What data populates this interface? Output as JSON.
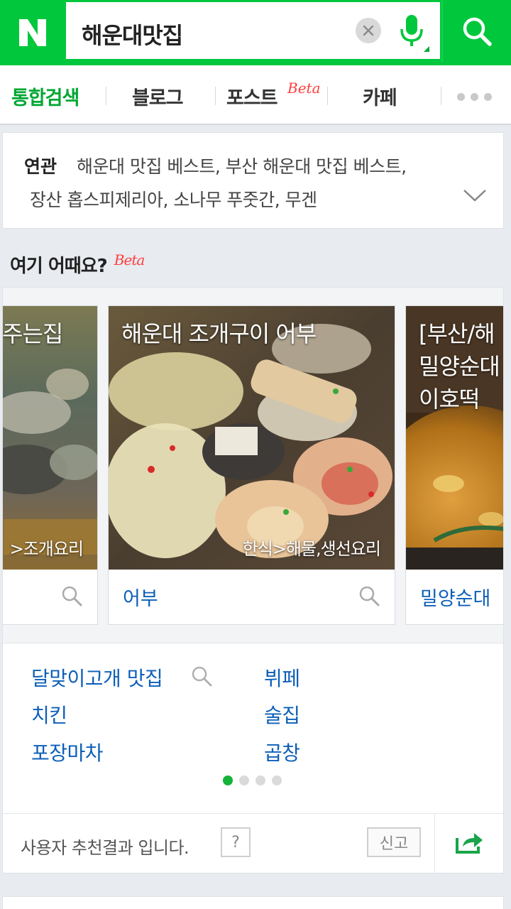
{
  "colors": {
    "brand": "#00c73c",
    "link": "#0d5fb8",
    "beta": "#ff3d3d"
  },
  "header": {
    "logo": "N",
    "query": "해운대맛집",
    "clear_icon": "close-icon",
    "mic_icon": "microphone-icon",
    "search_icon": "search-icon"
  },
  "tabs": [
    {
      "label": "통합검색",
      "active": true
    },
    {
      "label": "블로그"
    },
    {
      "label": "포스트",
      "badge": "Beta"
    },
    {
      "label": "카페"
    }
  ],
  "related": {
    "label": "연관",
    "line1": "해운대 맛집 베스트, 부산 해운대 맛집 베스트,",
    "line2": "장산 홉스피제리아, 소나무 푸줏간, 무겐"
  },
  "section": {
    "title": "여기 어때요?",
    "badge": "Beta"
  },
  "cards": [
    {
      "title": "주는집\n",
      "category": ">조개요리",
      "name": ""
    },
    {
      "title": "해운대 조개구이 어부",
      "category": "한식>해물,생선요리",
      "name": "어부"
    },
    {
      "title": "[부산/해\n밀양순대\n이호떡",
      "category": "",
      "name": "밀양순대"
    }
  ],
  "keywords": [
    "달맞이고개 맛집",
    "뷔페",
    "치킨",
    "술집",
    "포장마차",
    "곱창"
  ],
  "pager": {
    "total": 4,
    "active": 1
  },
  "footer": {
    "text": "사용자 추천결과 입니다.",
    "help": "?",
    "report": "신고",
    "share_icon": "share-icon"
  }
}
